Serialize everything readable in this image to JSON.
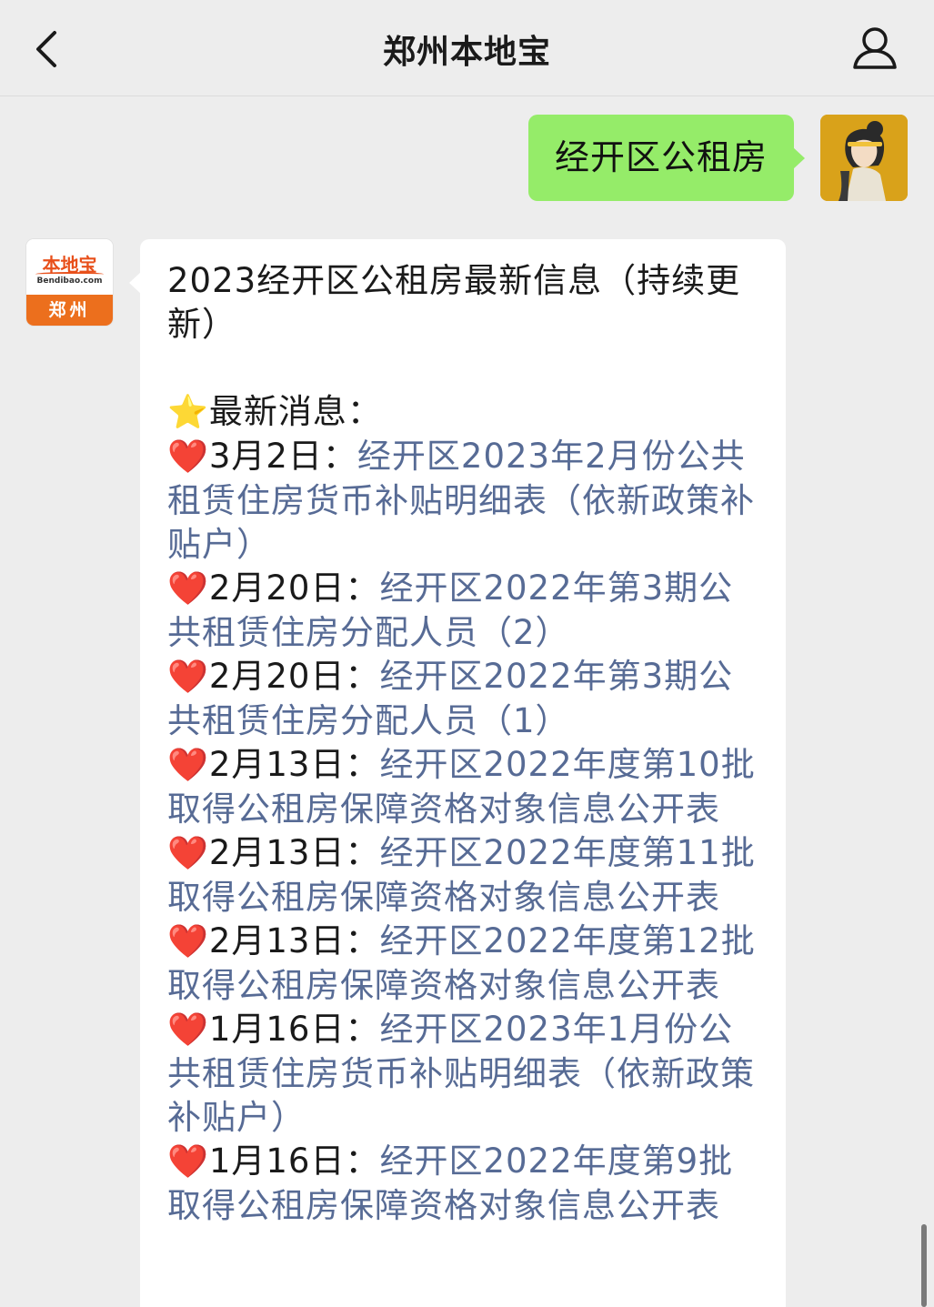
{
  "header": {
    "title": "郑州本地宝",
    "back_icon": "chevron-left-icon",
    "profile_icon": "person-icon"
  },
  "outgoing": {
    "text": "经开区公租房"
  },
  "bot_avatar": {
    "logo_text": "本地宝",
    "logo_sub": "Bendibao.com",
    "city": "郑州"
  },
  "message": {
    "title": "2023经开区公租房最新信息（持续更新）",
    "section_icon": "⭐",
    "section_label": "最新消息：",
    "items": [
      {
        "icon": "❤️",
        "date": "3月2日：",
        "link": "经开区2023年2月份公共租赁住房货币补贴明细表（依新政策补贴户）"
      },
      {
        "icon": "❤️",
        "date": "2月20日：",
        "link": "经开区2022年第3期公共租赁住房分配人员（2）"
      },
      {
        "icon": "❤️",
        "date": "2月20日：",
        "link": "经开区2022年第3期公共租赁住房分配人员（1）"
      },
      {
        "icon": "❤️",
        "date": "2月13日：",
        "link": "经开区2022年度第10批取得公租房保障资格对象信息公开表"
      },
      {
        "icon": "❤️",
        "date": "2月13日：",
        "link": "经开区2022年度第11批取得公租房保障资格对象信息公开表"
      },
      {
        "icon": "❤️",
        "date": "2月13日：",
        "link": "经开区2022年度第12批取得公租房保障资格对象信息公开表"
      },
      {
        "icon": "❤️",
        "date": "1月16日：",
        "link": "经开区2023年1月份公共租赁住房货币补贴明细表（依新政策补贴户）"
      },
      {
        "icon": "❤️",
        "date": "1月16日：",
        "link": "经开区2022年度第9批取得公租房保障资格对象信息公开表"
      }
    ]
  },
  "colors": {
    "background": "#ededed",
    "outgoing_bubble": "#95ec69",
    "link": "#576b95",
    "heart": "#e0222e"
  }
}
